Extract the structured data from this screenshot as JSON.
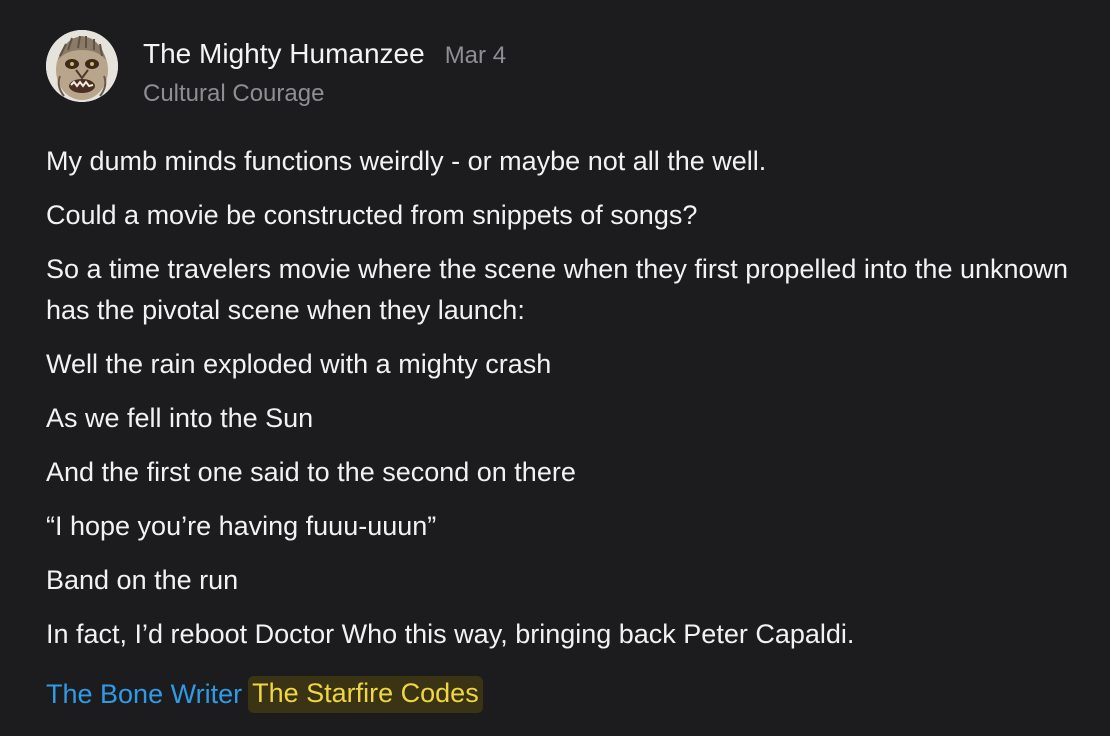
{
  "post": {
    "author": "The Mighty Humanzee",
    "date": "Mar 4",
    "publication": "Cultural Courage",
    "avatar_icon": "gorilla-face-avatar",
    "paragraphs": [
      "My dumb minds functions weirdly - or maybe not all the well.",
      "Could a movie be constructed from snippets of songs?",
      "So a time travelers movie where the scene when they first propelled into the unknown has the pivotal scene when they launch:",
      "Well the rain exploded with a mighty crash",
      "As we fell into the Sun",
      "And the first one said to the second on there",
      "“I hope you’re having fuuu-uuun”",
      "Band on the run",
      "In fact, I’d reboot Doctor Who this way, bringing back Peter Capaldi."
    ],
    "tags": {
      "link": "The Bone Writer",
      "highlighted": "The Starfire Codes"
    }
  },
  "colors": {
    "background": "#1c1c1e",
    "text": "#f2f2f4",
    "muted": "#8e8e93",
    "link": "#2f9be8",
    "highlight_text": "#f0d640",
    "highlight_bg": "#3b3414"
  }
}
